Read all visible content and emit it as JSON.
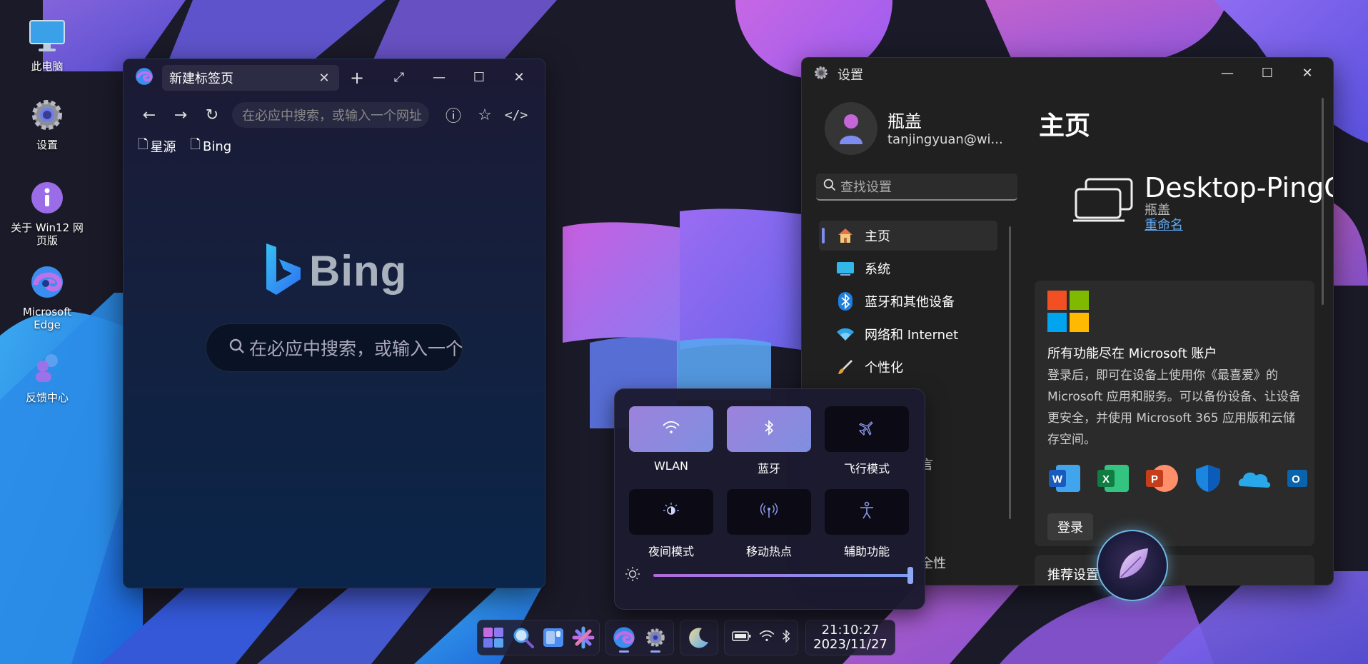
{
  "desktop": {
    "icons": [
      {
        "label": "此电脑",
        "icon": "computer-icon"
      },
      {
        "label": "设置",
        "icon": "gear-icon"
      },
      {
        "label": "关于 Win12 网页版",
        "icon": "info-icon"
      },
      {
        "label": "Microsoft Edge",
        "icon": "edge-icon"
      },
      {
        "label": "反馈中心",
        "icon": "feedback-icon"
      }
    ]
  },
  "edge": {
    "tab_title": "新建标签页",
    "address_placeholder": "在必应中搜索，或输入一个网址",
    "favorites": [
      "星源",
      "Bing"
    ],
    "bing_label": "Bing",
    "search_placeholder": "在必应中搜索，或输入一个网址"
  },
  "settings": {
    "window_title": "设置",
    "user_name": "瓶盖",
    "user_email": "tanjingyuan@wi...",
    "search_placeholder": "查找设置",
    "nav_items": [
      {
        "label": "主页",
        "icon": "home-icon",
        "active": true
      },
      {
        "label": "系统",
        "icon": "monitor-icon"
      },
      {
        "label": "蓝牙和其他设备",
        "icon": "bluetooth-icon"
      },
      {
        "label": "网络和 Internet",
        "icon": "wifi-icon"
      },
      {
        "label": "个性化",
        "icon": "brush-icon"
      }
    ],
    "nav_partial_1": "言",
    "nav_partial_2": "全性",
    "page_title": "主页",
    "device_name": "Desktop-PingGai",
    "device_user": "瓶盖",
    "rename_label": "重命名",
    "account_card": {
      "title": "所有功能尽在 Microsoft 账户",
      "body": "登录后，即可在设备上使用你《最喜爱》的 Microsoft 应用和服务。可以备份设备、让设备更安全，并使用 Microsoft 365 应用版和云储存空间。",
      "apps": [
        "word-icon",
        "excel-icon",
        "powerpoint-icon",
        "defender-icon",
        "onedrive-icon",
        "outlook-icon"
      ],
      "login_label": "登录"
    },
    "recommended_label": "推荐设置"
  },
  "quick_settings": {
    "tiles": [
      {
        "label": "WLAN",
        "icon": "wifi-icon",
        "on": true
      },
      {
        "label": "蓝牙",
        "icon": "bluetooth-icon",
        "on": true
      },
      {
        "label": "飞行模式",
        "icon": "airplane-icon",
        "on": false
      },
      {
        "label": "夜间模式",
        "icon": "night-mode-icon",
        "on": false
      },
      {
        "label": "移动热点",
        "icon": "hotspot-icon",
        "on": false
      },
      {
        "label": "辅助功能",
        "icon": "accessibility-icon",
        "on": false
      }
    ],
    "brightness": 1.0
  },
  "taskbar": {
    "time": "21:10:27",
    "date": "2023/11/27"
  },
  "colors": {
    "accent": "#7c8ef0",
    "link": "#60a8f0",
    "tile_on_start": "#9d82dc",
    "tile_on_end": "#7f8fe0"
  }
}
